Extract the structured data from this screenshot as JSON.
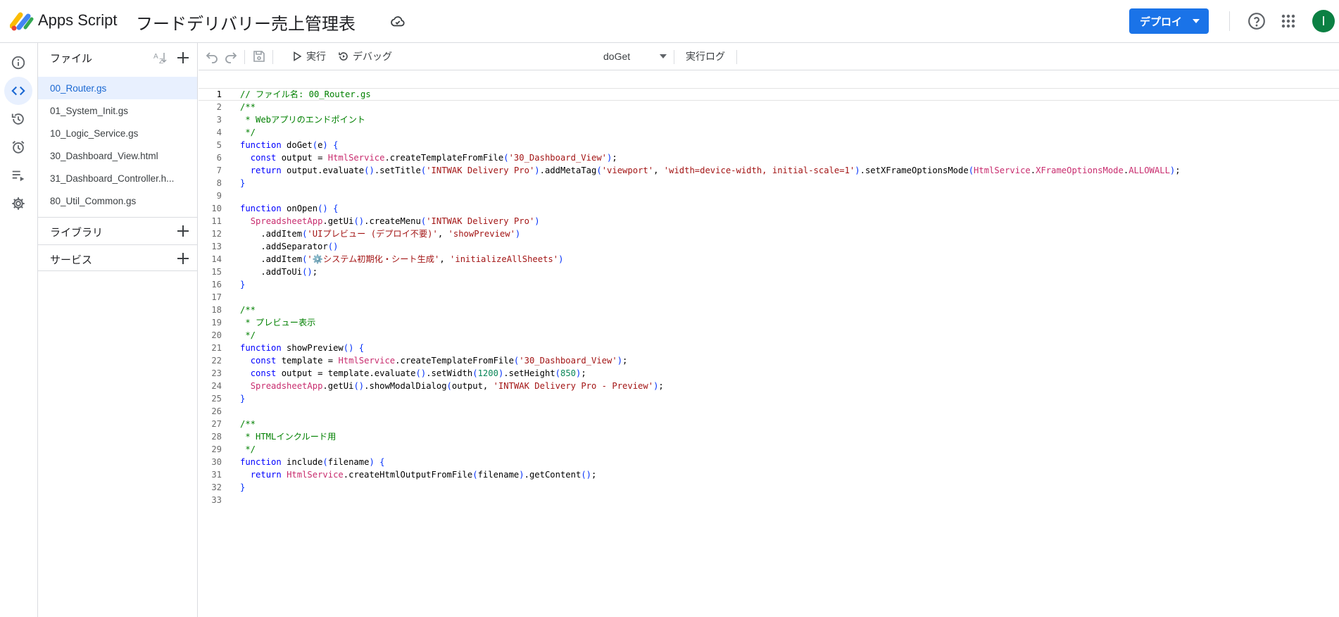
{
  "header": {
    "product_name": "Apps Script",
    "project_title": "フードデリバリー売上管理表",
    "deploy_label": "デプロイ",
    "avatar_letter": "I"
  },
  "sidebar": {
    "files_title": "ファイル",
    "files": [
      {
        "name": "00_Router.gs",
        "active": true
      },
      {
        "name": "01_System_Init.gs",
        "active": false
      },
      {
        "name": "10_Logic_Service.gs",
        "active": false
      },
      {
        "name": "30_Dashboard_View.html",
        "active": false
      },
      {
        "name": "31_Dashboard_Controller.h...",
        "active": false
      },
      {
        "name": "80_Util_Common.gs",
        "active": false
      }
    ],
    "libraries_title": "ライブラリ",
    "services_title": "サービス"
  },
  "toolbar": {
    "run_label": "実行",
    "debug_label": "デバッグ",
    "function_select": "doGet",
    "log_label": "実行ログ"
  },
  "editor": {
    "current_line": 1,
    "lines": [
      [
        [
          "c",
          "// ファイル名: 00_Router.gs"
        ]
      ],
      [
        [
          "c",
          "/**"
        ]
      ],
      [
        [
          "c",
          " * Webアプリのエンドポイント"
        ]
      ],
      [
        [
          "c",
          " */"
        ]
      ],
      [
        [
          "k",
          "function"
        ],
        [
          "p",
          " doGet"
        ],
        [
          "b",
          "("
        ],
        [
          "p",
          "e"
        ],
        [
          "b",
          ")"
        ],
        [
          "p",
          " "
        ],
        [
          "b",
          "{"
        ]
      ],
      [
        [
          "p",
          "  "
        ],
        [
          "k",
          "const"
        ],
        [
          "p",
          " output = "
        ],
        [
          "t",
          "HtmlService"
        ],
        [
          "p",
          ".createTemplateFromFile"
        ],
        [
          "b",
          "("
        ],
        [
          "s",
          "'30_Dashboard_View'"
        ],
        [
          "b",
          ")"
        ],
        [
          "p",
          ";"
        ]
      ],
      [
        [
          "p",
          "  "
        ],
        [
          "k",
          "return"
        ],
        [
          "p",
          " output.evaluate"
        ],
        [
          "b",
          "()"
        ],
        [
          "p",
          ".setTitle"
        ],
        [
          "b",
          "("
        ],
        [
          "s",
          "'INTWAK Delivery Pro'"
        ],
        [
          "b",
          ")"
        ],
        [
          "p",
          ".addMetaTag"
        ],
        [
          "b",
          "("
        ],
        [
          "s",
          "'viewport'"
        ],
        [
          "p",
          ", "
        ],
        [
          "s",
          "'width=device-width, initial-scale=1'"
        ],
        [
          "b",
          ")"
        ],
        [
          "p",
          ".setXFrameOptionsMode"
        ],
        [
          "b",
          "("
        ],
        [
          "t",
          "HtmlService"
        ],
        [
          "p",
          "."
        ],
        [
          "t",
          "XFrameOptionsMode"
        ],
        [
          "p",
          "."
        ],
        [
          "t",
          "ALLOWALL"
        ],
        [
          "b",
          ")"
        ],
        [
          "p",
          ";"
        ]
      ],
      [
        [
          "b",
          "}"
        ]
      ],
      [],
      [
        [
          "k",
          "function"
        ],
        [
          "p",
          " onOpen"
        ],
        [
          "b",
          "()"
        ],
        [
          "p",
          " "
        ],
        [
          "b",
          "{"
        ]
      ],
      [
        [
          "p",
          "  "
        ],
        [
          "t",
          "SpreadsheetApp"
        ],
        [
          "p",
          ".getUi"
        ],
        [
          "b",
          "()"
        ],
        [
          "p",
          ".createMenu"
        ],
        [
          "b",
          "("
        ],
        [
          "s",
          "'INTWAK Delivery Pro'"
        ],
        [
          "b",
          ")"
        ]
      ],
      [
        [
          "p",
          "    .addItem"
        ],
        [
          "b",
          "("
        ],
        [
          "s",
          "'UIプレビュー (デプロイ不要)'"
        ],
        [
          "p",
          ", "
        ],
        [
          "s",
          "'showPreview'"
        ],
        [
          "b",
          ")"
        ]
      ],
      [
        [
          "p",
          "    .addSeparator"
        ],
        [
          "b",
          "()"
        ]
      ],
      [
        [
          "p",
          "    .addItem"
        ],
        [
          "b",
          "("
        ],
        [
          "s",
          "'⚙️システム初期化・シート生成'"
        ],
        [
          "p",
          ", "
        ],
        [
          "s",
          "'initializeAllSheets'"
        ],
        [
          "b",
          ")"
        ]
      ],
      [
        [
          "p",
          "    .addToUi"
        ],
        [
          "b",
          "()"
        ],
        [
          "p",
          ";"
        ]
      ],
      [
        [
          "b",
          "}"
        ]
      ],
      [],
      [
        [
          "c",
          "/**"
        ]
      ],
      [
        [
          "c",
          " * プレビュー表示"
        ]
      ],
      [
        [
          "c",
          " */"
        ]
      ],
      [
        [
          "k",
          "function"
        ],
        [
          "p",
          " showPreview"
        ],
        [
          "b",
          "()"
        ],
        [
          "p",
          " "
        ],
        [
          "b",
          "{"
        ]
      ],
      [
        [
          "p",
          "  "
        ],
        [
          "k",
          "const"
        ],
        [
          "p",
          " template = "
        ],
        [
          "t",
          "HtmlService"
        ],
        [
          "p",
          ".createTemplateFromFile"
        ],
        [
          "b",
          "("
        ],
        [
          "s",
          "'30_Dashboard_View'"
        ],
        [
          "b",
          ")"
        ],
        [
          "p",
          ";"
        ]
      ],
      [
        [
          "p",
          "  "
        ],
        [
          "k",
          "const"
        ],
        [
          "p",
          " output = template.evaluate"
        ],
        [
          "b",
          "()"
        ],
        [
          "p",
          ".setWidth"
        ],
        [
          "b",
          "("
        ],
        [
          "n",
          "1200"
        ],
        [
          "b",
          ")"
        ],
        [
          "p",
          ".setHeight"
        ],
        [
          "b",
          "("
        ],
        [
          "n",
          "850"
        ],
        [
          "b",
          ")"
        ],
        [
          "p",
          ";"
        ]
      ],
      [
        [
          "p",
          "  "
        ],
        [
          "t",
          "SpreadsheetApp"
        ],
        [
          "p",
          ".getUi"
        ],
        [
          "b",
          "()"
        ],
        [
          "p",
          ".showModalDialog"
        ],
        [
          "b",
          "("
        ],
        [
          "p",
          "output, "
        ],
        [
          "s",
          "'INTWAK Delivery Pro - Preview'"
        ],
        [
          "b",
          ")"
        ],
        [
          "p",
          ";"
        ]
      ],
      [
        [
          "b",
          "}"
        ]
      ],
      [],
      [
        [
          "c",
          "/**"
        ]
      ],
      [
        [
          "c",
          " * HTMLインクルード用"
        ]
      ],
      [
        [
          "c",
          " */"
        ]
      ],
      [
        [
          "k",
          "function"
        ],
        [
          "p",
          " include"
        ],
        [
          "b",
          "("
        ],
        [
          "p",
          "filename"
        ],
        [
          "b",
          ")"
        ],
        [
          "p",
          " "
        ],
        [
          "b",
          "{"
        ]
      ],
      [
        [
          "p",
          "  "
        ],
        [
          "k",
          "return"
        ],
        [
          "p",
          " "
        ],
        [
          "t",
          "HtmlService"
        ],
        [
          "p",
          ".createHtmlOutputFromFile"
        ],
        [
          "b",
          "("
        ],
        [
          "p",
          "filename"
        ],
        [
          "b",
          ")"
        ],
        [
          "p",
          ".getContent"
        ],
        [
          "b",
          "()"
        ],
        [
          "p",
          ";"
        ]
      ],
      [
        [
          "b",
          "}"
        ]
      ],
      []
    ]
  },
  "colors": {
    "accent": "#1a73e8",
    "active_bg": "#e8f0fe",
    "active_text": "#1967d2",
    "avatar_bg": "#0b8043"
  }
}
